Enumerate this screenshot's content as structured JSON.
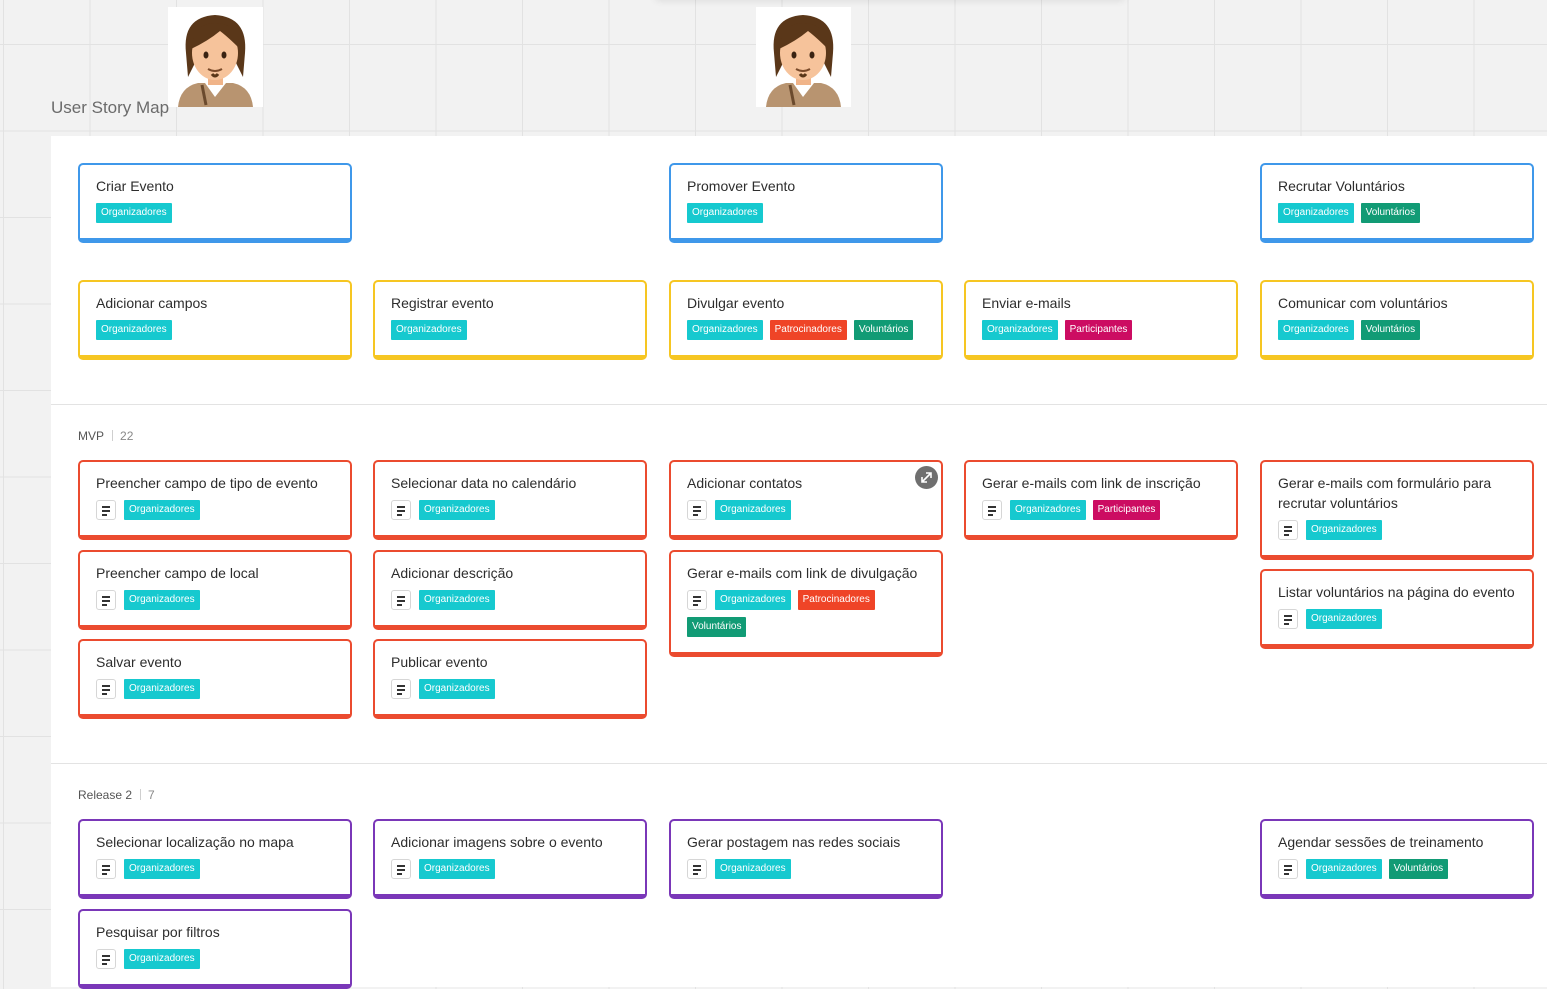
{
  "title": "User Story Map",
  "tag_colors": {
    "Organizadores": "#16c9cf",
    "Voluntários": "#119b75",
    "Patrocinadores": "#ef4427",
    "Participantes": "#cc0c62"
  },
  "releases": [
    {
      "label": "MVP",
      "count": "22"
    },
    {
      "label": "Release 2",
      "count": "7"
    }
  ],
  "activities": [
    {
      "title": "Criar Evento",
      "tags": [
        "Organizadores"
      ]
    },
    {
      "title": "Promover Evento",
      "tags": [
        "Organizadores"
      ]
    },
    {
      "title": "Recrutar Voluntários",
      "tags": [
        "Organizadores",
        "Voluntários"
      ]
    }
  ],
  "steps": [
    {
      "title": "Adicionar campos",
      "tags": [
        "Organizadores"
      ]
    },
    {
      "title": "Registrar evento",
      "tags": [
        "Organizadores"
      ]
    },
    {
      "title": "Divulgar evento",
      "tags": [
        "Organizadores",
        "Patrocinadores",
        "Voluntários"
      ]
    },
    {
      "title": "Enviar e-mails",
      "tags": [
        "Organizadores",
        "Participantes"
      ]
    },
    {
      "title": "Comunicar com voluntários",
      "tags": [
        "Organizadores",
        "Voluntários"
      ]
    }
  ],
  "mvp_stories": [
    {
      "title": "Preencher campo de tipo de evento",
      "tags": [
        "Organizadores"
      ]
    },
    {
      "title": "Preencher campo de local",
      "tags": [
        "Organizadores"
      ]
    },
    {
      "title": "Salvar evento",
      "tags": [
        "Organizadores"
      ]
    },
    {
      "title": "Selecionar data no calendário",
      "tags": [
        "Organizadores"
      ]
    },
    {
      "title": "Adicionar descrição",
      "tags": [
        "Organizadores"
      ]
    },
    {
      "title": "Publicar evento",
      "tags": [
        "Organizadores"
      ]
    },
    {
      "title": "Adicionar contatos",
      "tags": [
        "Organizadores"
      ]
    },
    {
      "title": "Gerar e-mails com link de divulgação",
      "tags": [
        "Organizadores",
        "Patrocinadores",
        "Voluntários"
      ]
    },
    {
      "title": "Gerar e-mails com link de inscrição",
      "tags": [
        "Organizadores",
        "Participantes"
      ]
    },
    {
      "title": "Gerar e-mails com formulário para recrutar voluntários",
      "tags": [
        "Organizadores"
      ]
    },
    {
      "title": "Listar voluntários na página do evento",
      "tags": [
        "Organizadores"
      ]
    }
  ],
  "release2_stories": [
    {
      "title": "Selecionar localização no mapa",
      "tags": [
        "Organizadores"
      ]
    },
    {
      "title": "Pesquisar por filtros",
      "tags": [
        "Organizadores"
      ]
    },
    {
      "title": "Adicionar imagens sobre o evento",
      "tags": [
        "Organizadores"
      ]
    },
    {
      "title": "Gerar postagem nas redes sociais",
      "tags": [
        "Organizadores"
      ]
    },
    {
      "title": "Agendar sessões de treinamento",
      "tags": [
        "Organizadores",
        "Voluntários"
      ]
    }
  ]
}
